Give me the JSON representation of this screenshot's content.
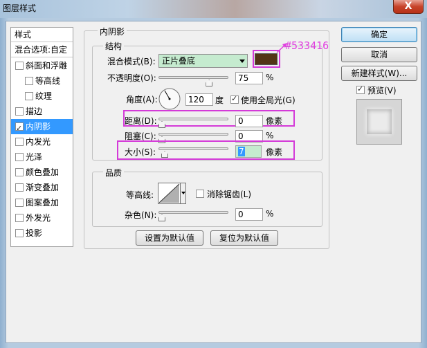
{
  "window": {
    "title": "图层样式",
    "close_label": "X"
  },
  "styles_list": {
    "header": "样式",
    "blend_options": "混合选项:自定",
    "items": [
      {
        "label": "斜面和浮雕",
        "checked": false
      },
      {
        "label": "等高线",
        "checked": false
      },
      {
        "label": "纹理",
        "checked": false
      },
      {
        "label": "描边",
        "checked": false
      },
      {
        "label": "内阴影",
        "checked": true
      },
      {
        "label": "内发光",
        "checked": false
      },
      {
        "label": "光泽",
        "checked": false
      },
      {
        "label": "颜色叠加",
        "checked": false
      },
      {
        "label": "渐变叠加",
        "checked": false
      },
      {
        "label": "图案叠加",
        "checked": false
      },
      {
        "label": "外发光",
        "checked": false
      },
      {
        "label": "投影",
        "checked": false
      }
    ]
  },
  "inner_shadow": {
    "title": "内阴影",
    "structure": {
      "title": "结构",
      "blend_mode_label": "混合模式(B):",
      "blend_mode_value": "正片叠底",
      "color": "#533416",
      "color_annotation": "#533416",
      "opacity_label": "不透明度(O):",
      "opacity_value": "75",
      "opacity_unit": "%",
      "opacity_fraction": 0.75,
      "angle_label": "角度(A):",
      "angle_value": "120",
      "angle_unit": "度",
      "global_light_label": "使用全局光(G)",
      "global_light_checked": true,
      "distance_label": "距离(D):",
      "distance_value": "0",
      "distance_unit": "像素",
      "choke_label": "阻塞(C):",
      "choke_value": "0",
      "choke_unit": "%",
      "size_label": "大小(S):",
      "size_value": "7",
      "size_unit": "像素"
    },
    "quality": {
      "title": "品质",
      "contour_label": "等高线:",
      "anti_alias_label": "消除锯齿(L)",
      "anti_alias_checked": false,
      "noise_label": "杂色(N):",
      "noise_value": "0",
      "noise_unit": "%"
    },
    "make_default_label": "设置为默认值",
    "reset_default_label": "复位为默认值"
  },
  "buttons": {
    "ok": "确定",
    "cancel": "取消",
    "new_style": "新建样式(W)...",
    "preview_label": "预览(V)",
    "preview_checked": true
  },
  "colors": {
    "highlight": "#d43ad8",
    "selection": "#3399ff",
    "annotation_text": "#e040e0"
  }
}
